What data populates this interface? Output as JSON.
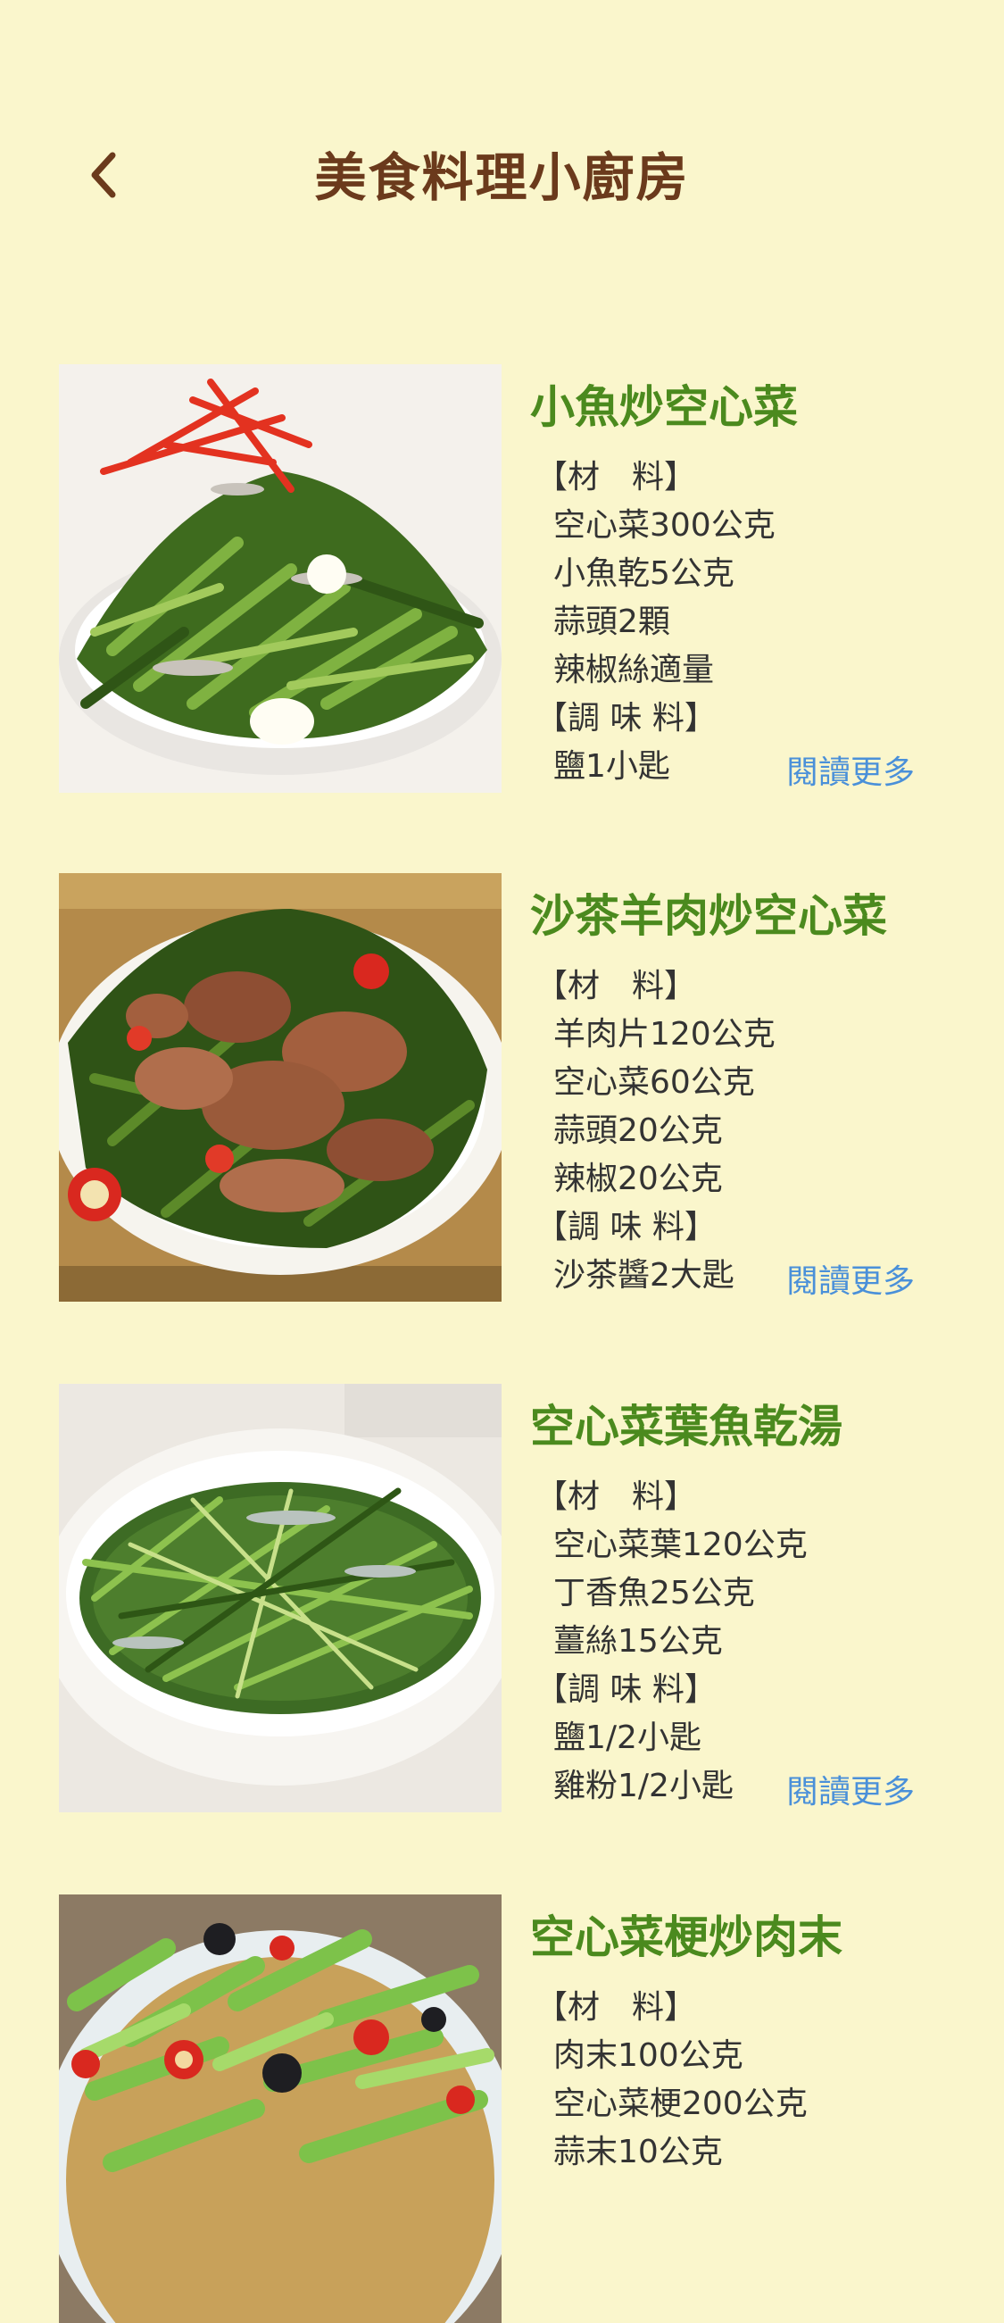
{
  "header": {
    "title": "美食料理小廚房",
    "back_icon": "chevron-left-icon"
  },
  "colors": {
    "background": "#FAF6CC",
    "title": "#6B3A1C",
    "recipe_title": "#4B8A1E",
    "link": "#4A90D9",
    "text": "#333333"
  },
  "read_more_label": "閱讀更多",
  "recipes": [
    {
      "title": "小魚炒空心菜",
      "ingredients_header": "【材　料】",
      "ingredients": [
        "空心菜300公克",
        "小魚乾5公克",
        "蒜頭2顆",
        "辣椒絲適量"
      ],
      "seasoning_header": "【調 味 料】",
      "seasoning": [
        "鹽1小匙"
      ]
    },
    {
      "title": "沙茶羊肉炒空心菜",
      "ingredients_header": "【材　料】",
      "ingredients": [
        "羊肉片120公克",
        "空心菜60公克",
        "蒜頭20公克",
        "辣椒20公克"
      ],
      "seasoning_header": "【調 味 料】",
      "seasoning": [
        "沙茶醬2大匙"
      ]
    },
    {
      "title": "空心菜葉魚乾湯",
      "ingredients_header": "【材　料】",
      "ingredients": [
        "空心菜葉120公克",
        "丁香魚25公克",
        "薑絲15公克"
      ],
      "seasoning_header": "【調 味 料】",
      "seasoning": [
        "鹽1/2小匙",
        "雞粉1/2小匙"
      ]
    },
    {
      "title": "空心菜梗炒肉末",
      "ingredients_header": "【材　料】",
      "ingredients": [
        "肉末100公克",
        "空心菜梗200公克",
        "蒜末10公克"
      ]
    }
  ]
}
